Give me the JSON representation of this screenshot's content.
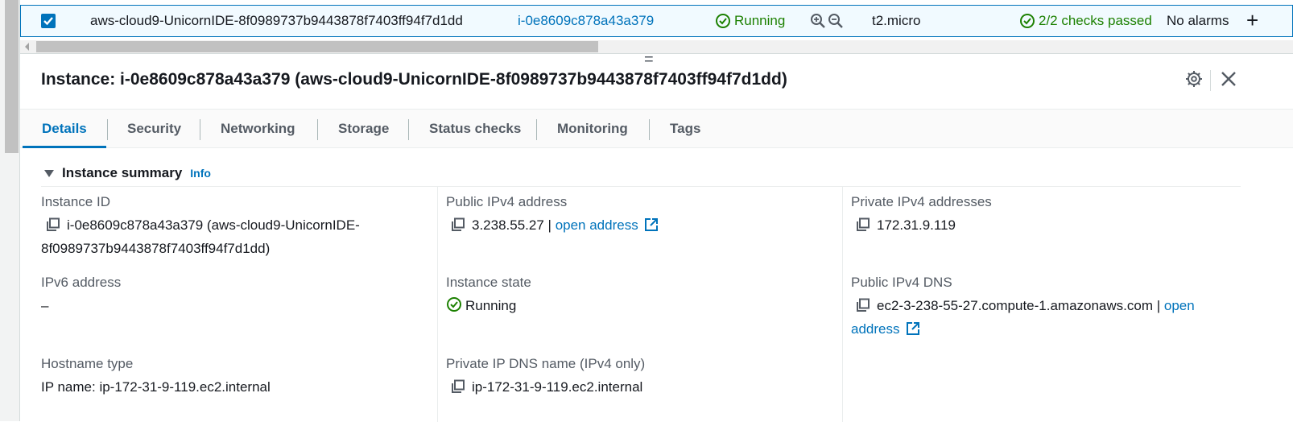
{
  "row": {
    "name": "aws-cloud9-UnicornIDE-8f0989737b9443878f7403ff94f7d1dd",
    "instance_id": "i-0e8609c878a43a379",
    "state": "Running",
    "instance_type": "t2.micro",
    "status_checks": "2/2 checks passed",
    "alarms": "No alarms",
    "add_alarm": "+"
  },
  "panel": {
    "drag_handle": "=",
    "title": "Instance: i-0e8609c878a43a379 (aws-cloud9-UnicornIDE-8f0989737b9443878f7403ff94f7d1dd)"
  },
  "tabs": [
    "Details",
    "Security",
    "Networking",
    "Storage",
    "Status checks",
    "Monitoring",
    "Tags"
  ],
  "summary": {
    "heading": "Instance summary",
    "info": "Info",
    "instance_id_label": "Instance ID",
    "instance_id_value": "i-0e8609c878a43a379 (aws-cloud9-UnicornIDE-",
    "instance_id_value2": "8f0989737b9443878f7403ff94f7d1dd)",
    "public_ipv4_label": "Public IPv4 address",
    "public_ipv4_value": "3.238.55.27 |",
    "open_address": "open address",
    "private_ipv4_label": "Private IPv4 addresses",
    "private_ipv4_value": "172.31.9.119",
    "ipv6_label": "IPv6 address",
    "ipv6_value": "–",
    "state_label": "Instance state",
    "state_value": "Running",
    "public_dns_label": "Public IPv4 DNS",
    "public_dns_value": "ec2-3-238-55-27.compute-1.amazonaws.com |",
    "public_dns_open": "open",
    "public_dns_open2": "address",
    "hostname_label": "Hostname type",
    "hostname_value": "IP name: ip-172-31-9-119.ec2.internal",
    "private_dns_label": "Private IP DNS name (IPv4 only)",
    "private_dns_value": "ip-172-31-9-119.ec2.internal"
  },
  "colors": {
    "link": "#0073bb",
    "success": "#1d8102",
    "text": "#16191f",
    "label": "#545b64"
  }
}
